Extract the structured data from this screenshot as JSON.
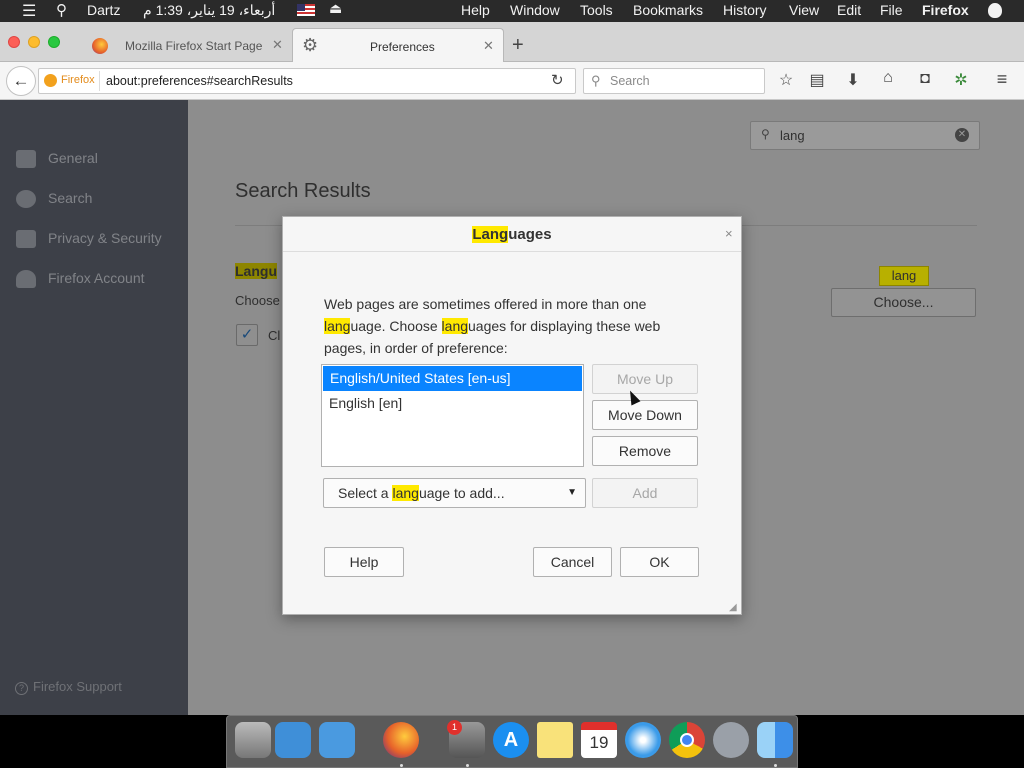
{
  "menubar": {
    "apple": "",
    "app": "Firefox",
    "items": [
      "File",
      "Edit",
      "View",
      "History",
      "Bookmarks",
      "Tools",
      "Window",
      "Help"
    ],
    "clock": "أربعاء، 19 يناير، 1:39 م",
    "user": "Dartz"
  },
  "tabs": [
    {
      "title": "Mozilla Firefox Start Page"
    },
    {
      "title": "Preferences"
    }
  ],
  "navbar": {
    "identity": "Firefox",
    "url": "about:preferences#searchResults",
    "search_placeholder": "Search"
  },
  "sidebar": {
    "items": [
      "General",
      "Search",
      "Privacy & Security",
      "Firefox Account"
    ],
    "support": "Firefox Support"
  },
  "main": {
    "filter_value": "lang",
    "heading": "Search Results",
    "section_title": "Langu",
    "section_desc": "Choose",
    "checkbox_label": "Cl",
    "tooltip": "lang",
    "choose_button": "Choose..."
  },
  "dialog": {
    "title_hl": "Lang",
    "title_rest": "uages",
    "close": "×",
    "desc": {
      "p1": "Web pages are sometimes offered in more than one",
      "hl1": "lang",
      "p2": "uage. Choose ",
      "hl2": "lang",
      "p3": "uages for displaying these web",
      "p4": "pages, in order of preference:"
    },
    "languages": [
      "English/United States  [en-us]",
      "English  [en]"
    ],
    "move_up": "Move Up",
    "move_down": "Move Down",
    "remove": "Remove",
    "select_pre": "Select a ",
    "select_hl": "lang",
    "select_post": "uage to add...",
    "add": "Add",
    "help": "Help",
    "cancel": "Cancel",
    "ok": "OK"
  },
  "dock": {
    "calendar_day": "19",
    "badge": "1"
  },
  "colors": {
    "accent": "#0a84ff",
    "highlight": "#ffe900"
  }
}
